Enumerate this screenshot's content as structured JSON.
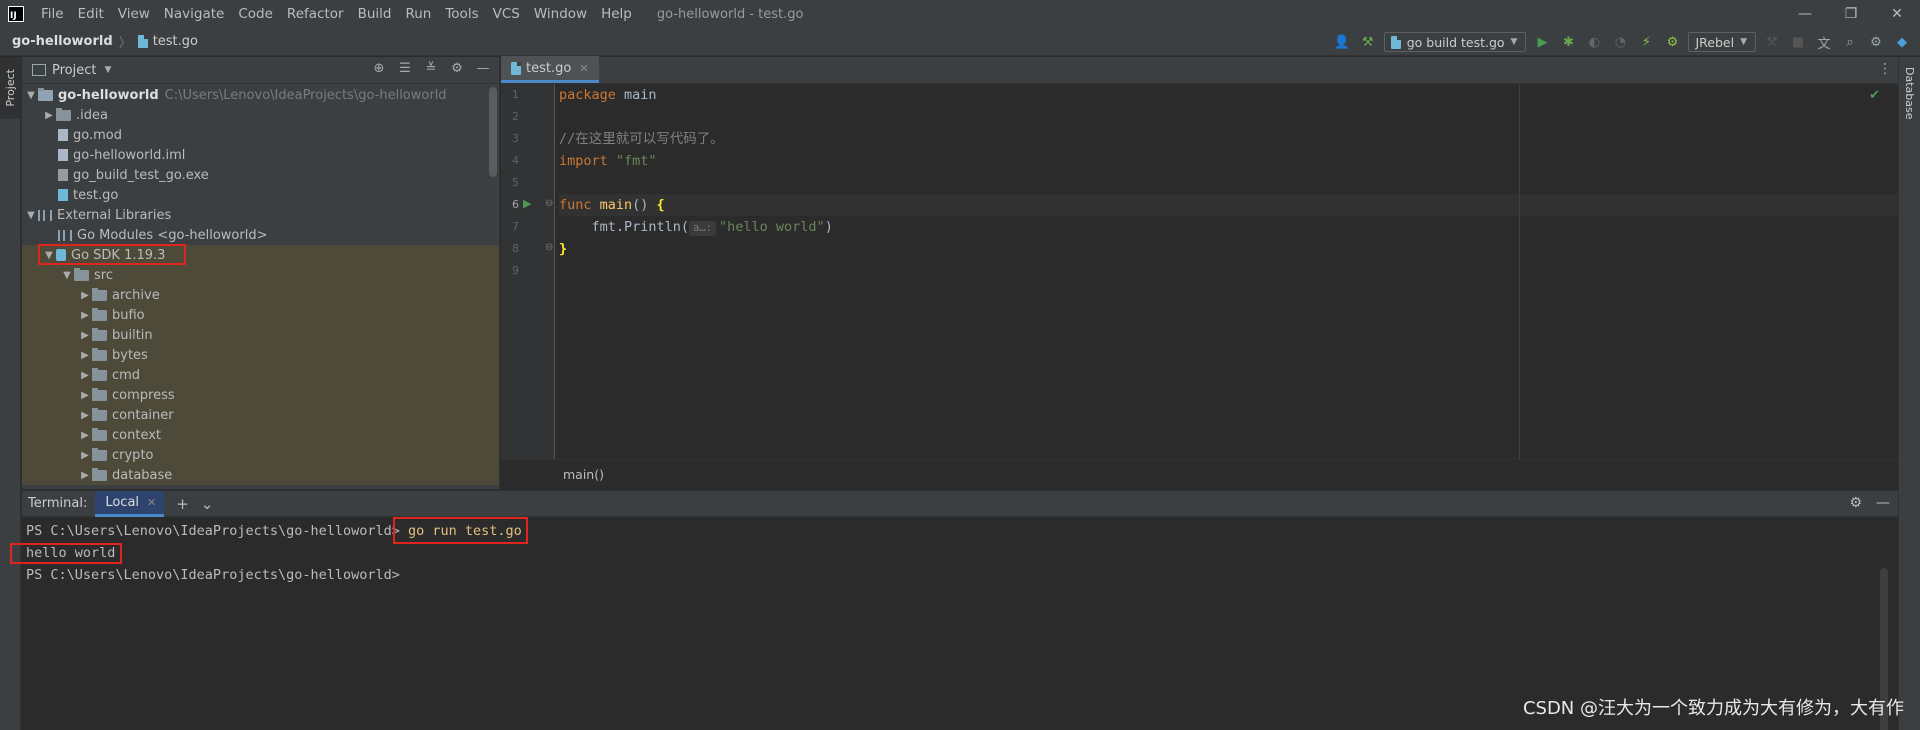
{
  "app": {
    "logo": "IJ",
    "window_title": "go-helloworld - test.go"
  },
  "menu": [
    "File",
    "Edit",
    "View",
    "Navigate",
    "Code",
    "Refactor",
    "Build",
    "Run",
    "Tools",
    "VCS",
    "Window",
    "Help"
  ],
  "window_controls": {
    "minimize": "—",
    "restore": "❐",
    "close": "✕"
  },
  "navbar": {
    "project": "go-helloworld",
    "file": "test.go"
  },
  "toolbar": {
    "run_config": "go build test.go",
    "jrebel": "JRebel"
  },
  "stripe": {
    "project": "Project",
    "database": "Database"
  },
  "project_panel": {
    "title": "Project",
    "tree": [
      {
        "label": "go-helloworld",
        "path": "C:\\Users\\Lenovo\\IdeaProjects\\go-helloworld"
      },
      {
        "label": ".idea"
      },
      {
        "label": "go.mod"
      },
      {
        "label": "go-helloworld.iml"
      },
      {
        "label": "go_build_test_go.exe"
      },
      {
        "label": "test.go"
      },
      {
        "label": "External Libraries"
      },
      {
        "label": "Go Modules <go-helloworld>"
      },
      {
        "label": "Go SDK 1.19.3"
      },
      {
        "label": "src"
      },
      {
        "label": "archive"
      },
      {
        "label": "bufio"
      },
      {
        "label": "builtin"
      },
      {
        "label": "bytes"
      },
      {
        "label": "cmd"
      },
      {
        "label": "compress"
      },
      {
        "label": "container"
      },
      {
        "label": "context"
      },
      {
        "label": "crypto"
      },
      {
        "label": "database"
      }
    ]
  },
  "editor": {
    "tab": "test.go",
    "line_numbers": [
      "1",
      "2",
      "3",
      "4",
      "5",
      "6",
      "7",
      "8",
      "9"
    ],
    "code": {
      "l1_kw": "package",
      "l1_rest": " main",
      "l3_comment": "//在这里就可以写代码了。",
      "l4_kw": "import",
      "l4_str": " \"fmt\"",
      "l6_kw": "func",
      "l6_fn": " main",
      "l6_rest": "() ",
      "l6_brace": "{",
      "l7_pre": "    fmt.Println(",
      "l7_hint": "a…:",
      "l7_str": "\"hello world\"",
      "l7_post": ")",
      "l8_brace": "}"
    },
    "breadcrumb": "main()"
  },
  "terminal": {
    "label": "Terminal:",
    "tab": "Local",
    "prompt": "PS C:\\Users\\Lenovo\\IdeaProjects\\go-helloworld>",
    "command": " go run test.go",
    "output": "hello world",
    "prompt2": "PS C:\\Users\\Lenovo\\IdeaProjects\\go-helloworld>"
  },
  "watermark": "CSDN @汪大为一个致力成为大有修为，大有作",
  "colors": {
    "highlight_box": "#e0241e",
    "accent": "#4a88c7"
  }
}
